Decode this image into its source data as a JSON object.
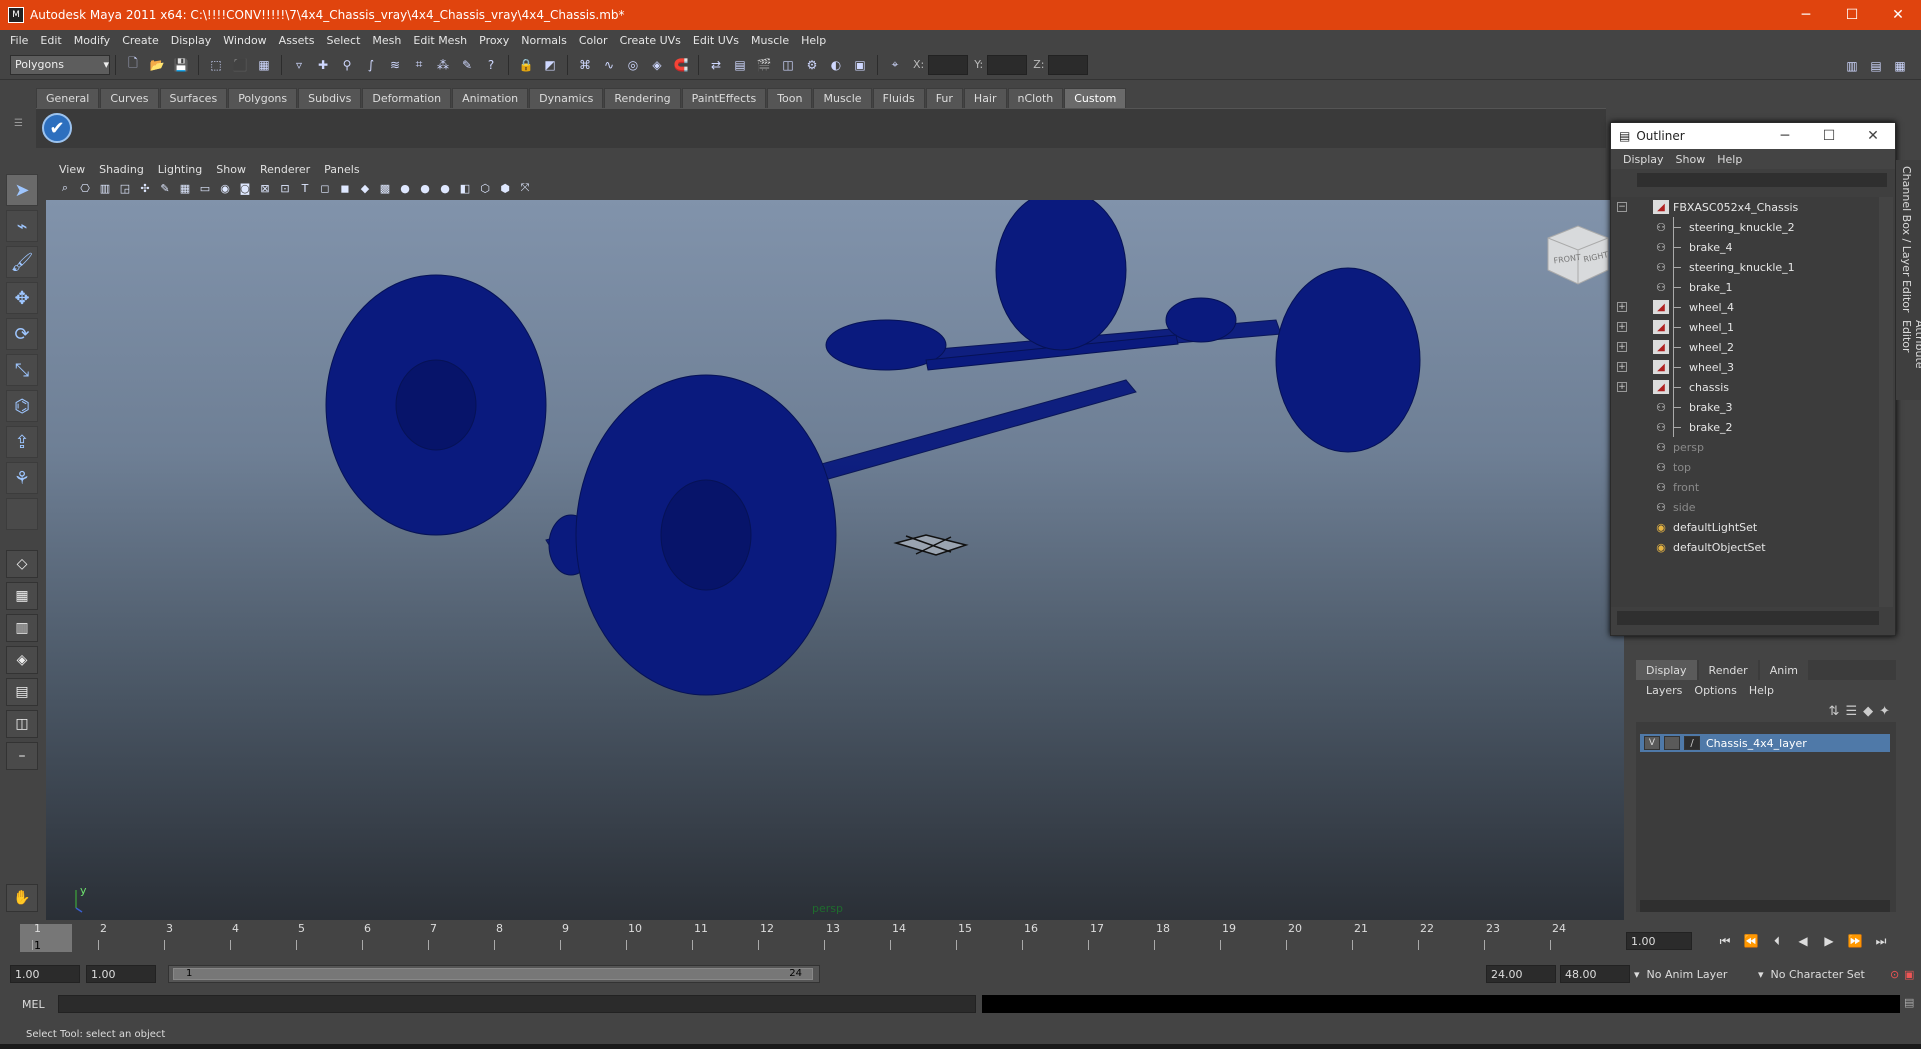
{
  "window": {
    "title": "Autodesk Maya 2011 x64: C:\\!!!!CONV!!!!!\\7\\4x4_Chassis_vray\\4x4_Chassis_vray\\4x4_Chassis.mb*",
    "minimize": "─",
    "maximize": "☐",
    "close": "✕",
    "app_icon": "M"
  },
  "menubar": [
    "File",
    "Edit",
    "Modify",
    "Create",
    "Display",
    "Window",
    "Assets",
    "Select",
    "Mesh",
    "Edit Mesh",
    "Proxy",
    "Normals",
    "Color",
    "Create UVs",
    "Edit UVs",
    "Muscle",
    "Help"
  ],
  "statusline": {
    "mode": "Polygons",
    "x_label": "X:",
    "y_label": "Y:",
    "z_label": "Z:"
  },
  "shelf": {
    "tabs": [
      "General",
      "Curves",
      "Surfaces",
      "Polygons",
      "Subdivs",
      "Deformation",
      "Animation",
      "Dynamics",
      "Rendering",
      "PaintEffects",
      "Toon",
      "Muscle",
      "Fluids",
      "Fur",
      "Hair",
      "nCloth",
      "Custom"
    ],
    "active_tab": "Custom"
  },
  "panel": {
    "menus": [
      "View",
      "Shading",
      "Lighting",
      "Show",
      "Renderer",
      "Panels"
    ],
    "camera_label": "persp",
    "viewcube_front": "FRONT",
    "viewcube_right": "RIGHT",
    "axis_y": "y"
  },
  "outliner": {
    "title": "Outliner",
    "menus": [
      "Display",
      "Show",
      "Help"
    ],
    "items": [
      {
        "label": "FBXASC052x4_Chassis",
        "icon": "mesh-icon",
        "indent": 0,
        "expander": "−",
        "dim": false
      },
      {
        "label": "steering_knuckle_2",
        "icon": "camera-icon",
        "indent": 1,
        "expander": "",
        "dim": false
      },
      {
        "label": "brake_4",
        "icon": "camera-icon",
        "indent": 1,
        "expander": "",
        "dim": false
      },
      {
        "label": "steering_knuckle_1",
        "icon": "camera-icon",
        "indent": 1,
        "expander": "",
        "dim": false
      },
      {
        "label": "brake_1",
        "icon": "camera-icon",
        "indent": 1,
        "expander": "",
        "dim": false
      },
      {
        "label": "wheel_4",
        "icon": "mesh-icon",
        "indent": 1,
        "expander": "+",
        "dim": false
      },
      {
        "label": "wheel_1",
        "icon": "mesh-icon",
        "indent": 1,
        "expander": "+",
        "dim": false
      },
      {
        "label": "wheel_2",
        "icon": "mesh-icon",
        "indent": 1,
        "expander": "+",
        "dim": false
      },
      {
        "label": "wheel_3",
        "icon": "mesh-icon",
        "indent": 1,
        "expander": "+",
        "dim": false
      },
      {
        "label": "chassis",
        "icon": "mesh-icon",
        "indent": 1,
        "expander": "+",
        "dim": false
      },
      {
        "label": "brake_3",
        "icon": "camera-icon",
        "indent": 1,
        "expander": "",
        "dim": false
      },
      {
        "label": "brake_2",
        "icon": "camera-icon",
        "indent": 1,
        "expander": "",
        "dim": false
      },
      {
        "label": "persp",
        "icon": "camera-icon",
        "indent": 0,
        "expander": "",
        "dim": true
      },
      {
        "label": "top",
        "icon": "camera-icon",
        "indent": 0,
        "expander": "",
        "dim": true
      },
      {
        "label": "front",
        "icon": "camera-icon",
        "indent": 0,
        "expander": "",
        "dim": true
      },
      {
        "label": "side",
        "icon": "camera-icon",
        "indent": 0,
        "expander": "",
        "dim": true
      },
      {
        "label": "defaultLightSet",
        "icon": "set-icon",
        "indent": 0,
        "expander": "",
        "dim": false
      },
      {
        "label": "defaultObjectSet",
        "icon": "set-icon",
        "indent": 0,
        "expander": "",
        "dim": false
      }
    ]
  },
  "side_tabs": [
    "Channel Box / Layer Editor",
    "Attribute Editor"
  ],
  "layer_editor": {
    "tabs": [
      "Display",
      "Render",
      "Anim"
    ],
    "active_tab": "Display",
    "menus": [
      "Layers",
      "Options",
      "Help"
    ],
    "layer": {
      "visible": "V",
      "name": "Chassis_4x4_layer"
    }
  },
  "timeline": {
    "ticks": [
      "1",
      "2",
      "3",
      "4",
      "5",
      "6",
      "7",
      "8",
      "9",
      "10",
      "11",
      "12",
      "13",
      "14",
      "15",
      "16",
      "17",
      "18",
      "19",
      "20",
      "21",
      "22",
      "23",
      "24"
    ],
    "current_frame_marker": "1",
    "current_frame": "1.00"
  },
  "range": {
    "start": "1.00",
    "playback_start": "1.00",
    "range_start_label": "1",
    "range_end_label": "24",
    "playback_end": "24.00",
    "end": "48.00",
    "anim_layer": "No Anim Layer",
    "character_set": "No Character Set"
  },
  "command": {
    "label": "MEL"
  },
  "helpline": "Select Tool: select an object",
  "colors": {
    "titlebar": "#e0440e",
    "wireframe": "#0b1a7a",
    "selected_layer": "#4f79a8"
  }
}
